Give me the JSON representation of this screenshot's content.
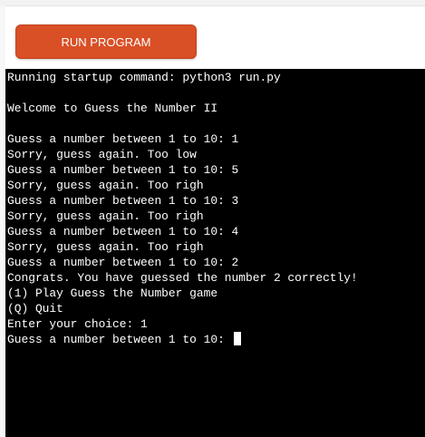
{
  "toolbar": {
    "run_label": "RUN PROGRAM"
  },
  "terminal": {
    "lines": [
      "Running startup command: python3 run.py",
      "",
      "Welcome to Guess the Number II",
      "",
      "Guess a number between 1 to 10: 1",
      "Sorry, guess again. Too low",
      "Guess a number between 1 to 10: 5",
      "Sorry, guess again. Too righ",
      "Guess a number between 1 to 10: 3",
      "Sorry, guess again. Too righ",
      "Guess a number between 1 to 10: 4",
      "Sorry, guess again. Too righ",
      "Guess a number between 1 to 10: 2",
      "Congrats. You have guessed the number 2 correctly!",
      "(1) Play Guess the Number game",
      "(Q) Quit",
      "Enter your choice: 1",
      "Guess a number between 1 to 10: "
    ]
  },
  "colors": {
    "button": "#d94f26",
    "terminal_bg": "#000000",
    "terminal_fg": "#ffffff"
  }
}
